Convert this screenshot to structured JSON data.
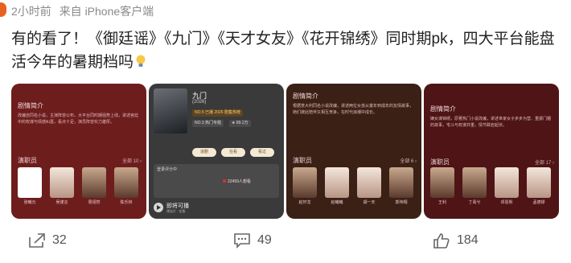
{
  "post": {
    "time": "2小时前",
    "source": "来自 iPhone客户端",
    "text": "有的看了！《御廷谣》《九门》《天才女友》《花开锦绣》同时期pk，四大平台能盘活今年的暑期档吗",
    "bulb_icon": "lightbulb-icon"
  },
  "cards": [
    {
      "section": "剧情简介",
      "blurb": "改编自同名小说，主演阵容公布，大平台同时期强势上线，讲述宫廷中的权谋与情感纠葛，看点十足，演员阵容实力雄厚。",
      "cast_label": "演职员",
      "cast_all": "全部 10 ›",
      "cast": [
        "张曦元",
        "吴谨言",
        "周翊然",
        "陈乐林"
      ]
    },
    {
      "title": "九门",
      "year": "(2026)",
      "rank1": "NO.5  已播 2026 剧集热榜",
      "rank2": "NO.3  热门专题",
      "rank3": "★ 89.2万",
      "buttons": [
        "追剧",
        "在看",
        "看过"
      ],
      "trailer_head": "登录评分中",
      "trailer_count": "22459人想看",
      "soon": "即将可播",
      "soon_sub": "预告片 · 花絮"
    },
    {
      "section": "剧情简介",
      "blurb": "根据意大利同名小说改编，讲述两位女孩从童年到成年的友情故事，她们彼此陪伴又相互竞争，在时代浪潮中成长。",
      "cast_label": "演职员",
      "cast_all": "全部 6 ›",
      "cast": [
        "赵轩龙",
        "赵曦曦",
        "胡一天",
        "郭伟翔"
      ]
    },
    {
      "section": "剧情简介",
      "blurb": "嫡女谋锦绣，原著热门小说改编，讲述世家女子步步为营、重振门楣的故事，宅斗与权谋并重，情节跌宕起伏。",
      "cast_label": "演职员",
      "cast_all": "全部 17 ›",
      "cast": [
        "王利",
        "丁禹兮",
        "邓恩熙",
        "孟德镠"
      ]
    }
  ],
  "actions": {
    "share_count": "32",
    "comment_count": "49",
    "like_count": "184"
  },
  "colors": {
    "card1": "#6e1d1d",
    "card2": "#3a3a3a",
    "card3": "#3b2016",
    "card4": "#4e1416",
    "meta_text": "#8a8a8a"
  }
}
